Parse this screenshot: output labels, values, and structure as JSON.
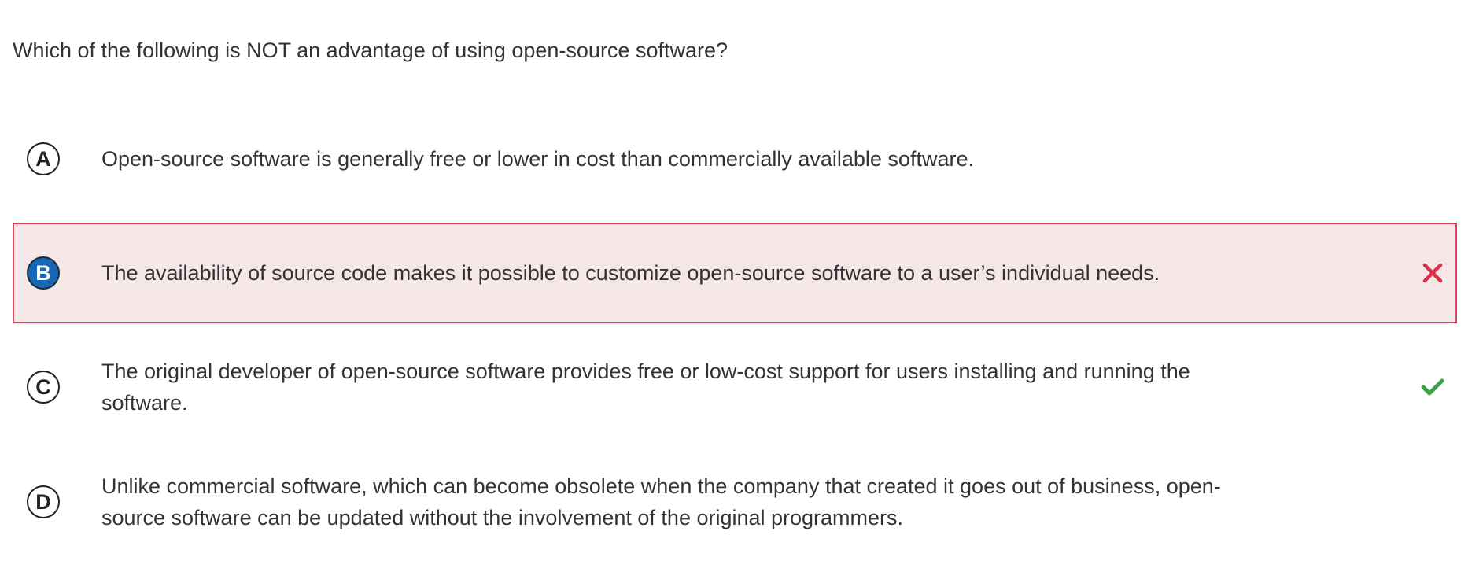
{
  "question": {
    "text": "Which of the following is NOT an advantage of using open-source software?"
  },
  "choices": [
    {
      "letter": "A",
      "text": "Open-source software is generally free or lower in cost than commercially available software.",
      "state": "default"
    },
    {
      "letter": "B",
      "text": "The availability of source code makes it possible to customize open-source software to a user’s individual needs.",
      "state": "selected-incorrect",
      "mark_icon": "x-icon"
    },
    {
      "letter": "C",
      "text": "The original developer of open-source software provides free or low-cost support for users installing and running the software.",
      "state": "correct",
      "mark_icon": "checkmark-icon"
    },
    {
      "letter": "D",
      "text": "Unlike commercial software, which can become obsolete when the company that created it goes out of business, open-source software can be updated without the involvement of the original programmers.",
      "state": "default"
    }
  ],
  "colors": {
    "selected_background": "#f5e6e8",
    "selected_border": "#d9465a",
    "selected_letter_fill": "#1767b5",
    "incorrect_mark": "#d93148",
    "correct_mark": "#3aa346",
    "text": "#333333"
  }
}
